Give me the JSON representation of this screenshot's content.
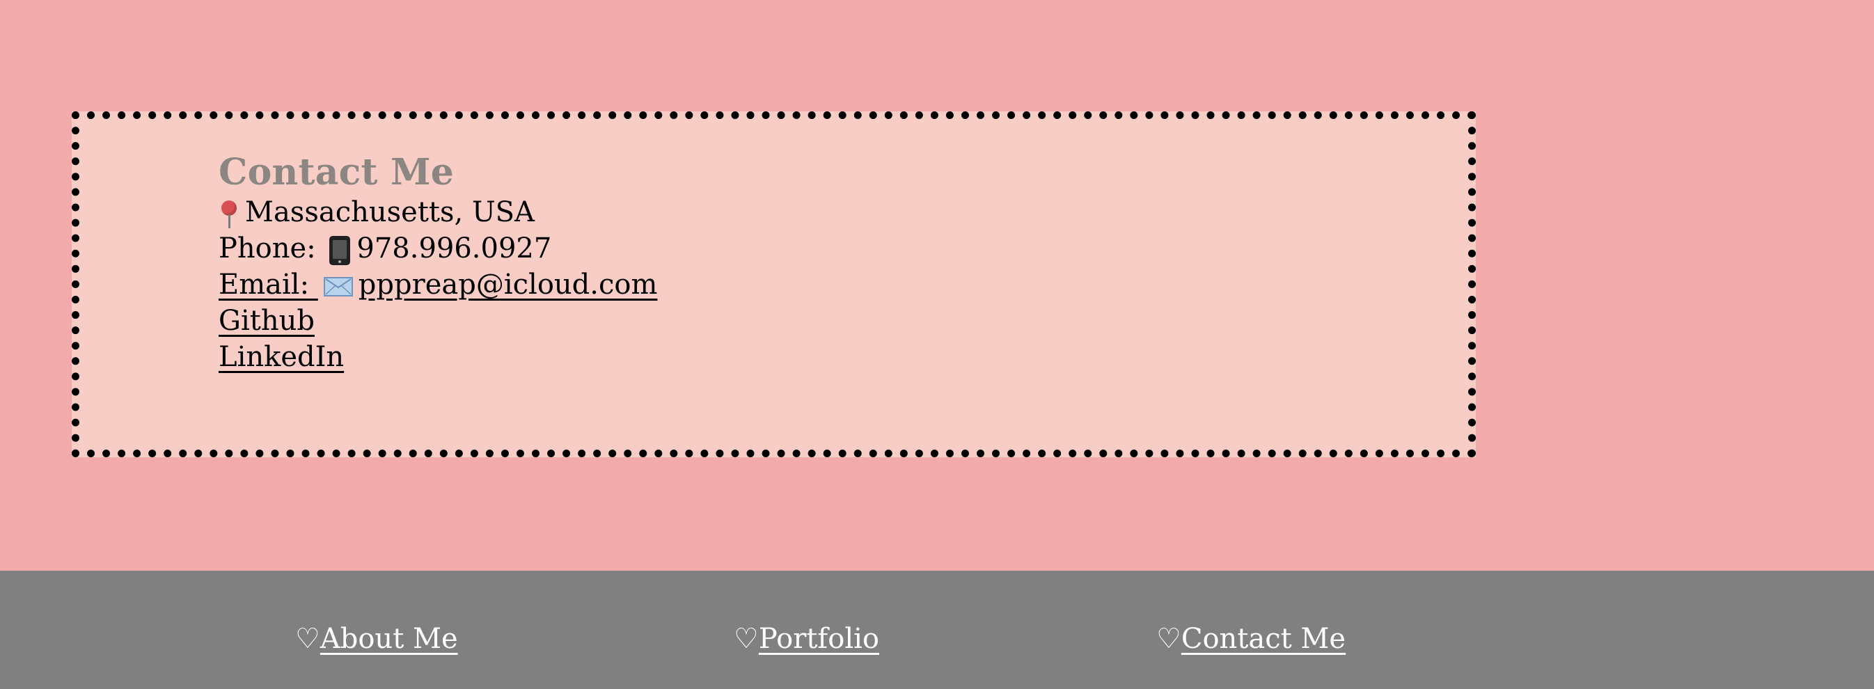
{
  "contact": {
    "title": "Contact Me",
    "location": "Massachusetts, USA",
    "phone_prefix": "Phone: ",
    "phone": "978.996.0927",
    "email_prefix": "Email: ",
    "email": "pppreap@icloud.com",
    "github": "Github",
    "linkedin": "LinkedIn",
    "icons": {
      "location": "location-pin-icon",
      "phone": "mobile-phone-icon",
      "email": "envelope-icon"
    }
  },
  "footer": {
    "links": [
      {
        "icon": "♡",
        "label": "About Me"
      },
      {
        "icon": "♡",
        "label": "Portfolio"
      },
      {
        "icon": "♡",
        "label": "Contact Me"
      }
    ]
  },
  "colors": {
    "page_background": "#f2aaaa",
    "card_background": "#f8cdc6",
    "card_border": "#000000",
    "title": "#8b8682",
    "footer_background": "#808080",
    "footer_text": "#ffffff"
  }
}
